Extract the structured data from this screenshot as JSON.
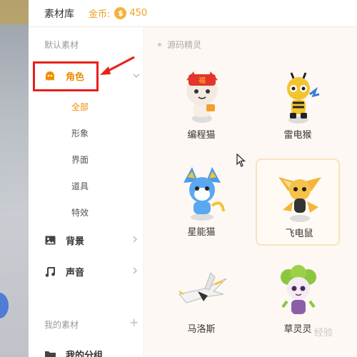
{
  "header": {
    "title": "素材库",
    "coin_label": "金币:",
    "coin_symbol": "$",
    "coin_value": "450"
  },
  "sidebar": {
    "default_title": "默认素材",
    "categories": [
      {
        "label": "角色",
        "icon": "ghost-icon",
        "arrow": "chevron-down-icon",
        "active": true
      },
      {
        "label": "背景",
        "icon": "image-icon",
        "arrow": "chevron-right-icon"
      },
      {
        "label": "声音",
        "icon": "music-note-icon",
        "arrow": "chevron-right-icon"
      }
    ],
    "subitems": [
      "全部",
      "形象",
      "界面",
      "道具",
      "特效"
    ],
    "my_title": "我的素材",
    "my_add": "+",
    "my_group": "我的分组"
  },
  "content": {
    "breadcrumb": "源码精灵",
    "cards": [
      {
        "name": "编程猫"
      },
      {
        "name": "雷电猴"
      },
      {
        "name": "星能猫"
      },
      {
        "name": "飞电鼠"
      },
      {
        "name": "马洛斯"
      },
      {
        "name": "草灵灵"
      }
    ]
  },
  "colors": {
    "accent": "#f08c00",
    "highlight_box": "#e8211d",
    "coin": "#f3b33a",
    "content_bg": "#fdf8f3"
  },
  "watermark": "经验"
}
